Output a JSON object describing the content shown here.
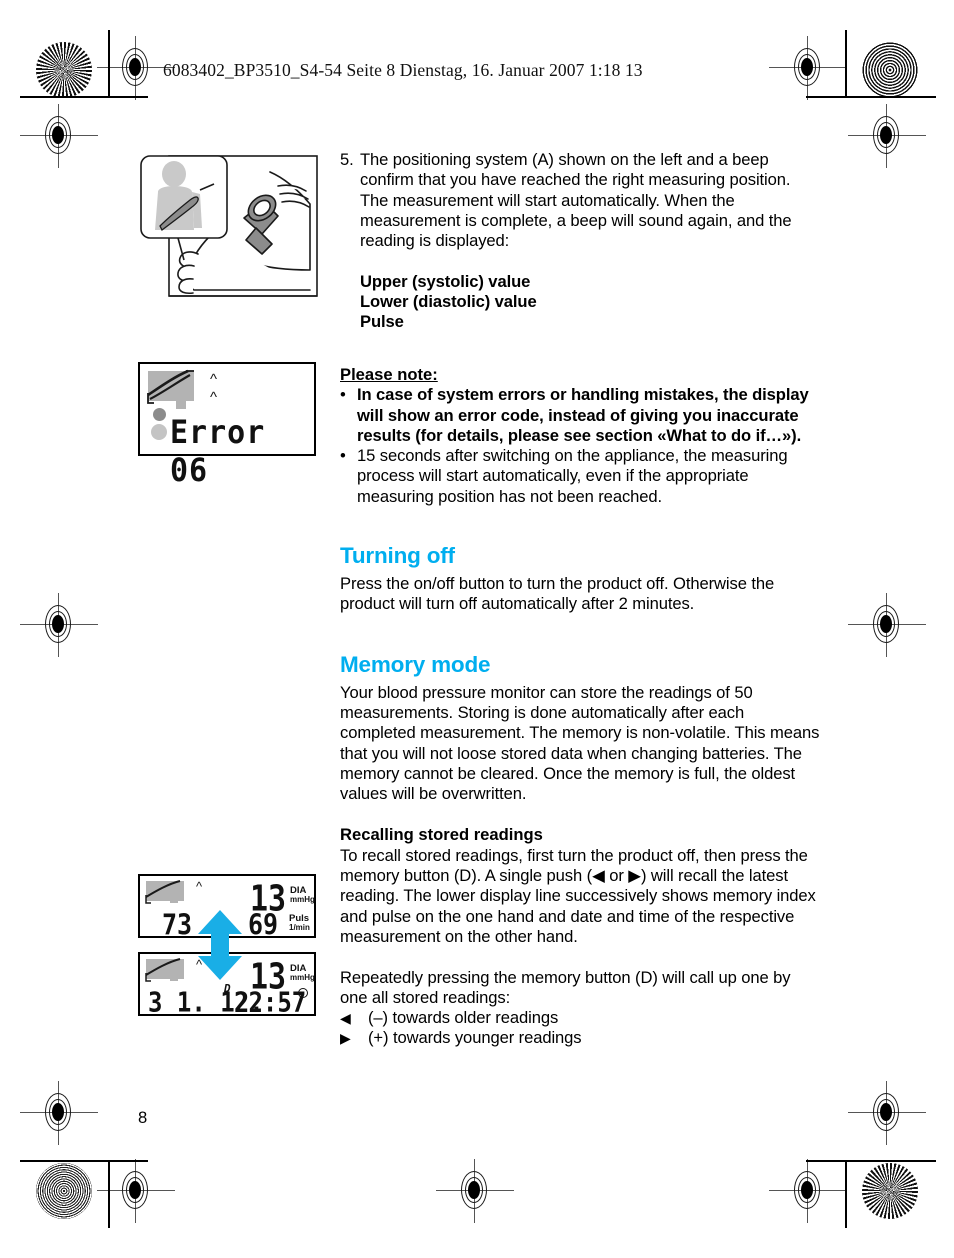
{
  "header": {
    "text": "6083402_BP3510_S4-54  Seite 8  Dienstag, 16. Januar 2007  1:18 13"
  },
  "page_number": "8",
  "colors": {
    "heading_blue": "#00AEEF",
    "lcd_gray": "#b3b3b3",
    "text_black": "#000000"
  },
  "content": {
    "step5": {
      "number": "5.",
      "text": "The positioning system (A) shown on the left and a beep confirm that you have reached the right measuring position. The measurement will start automatically. When the measurement is complete, a beep will sound again, and the reading is displayed:"
    },
    "reading_labels": [
      "Upper (systolic) value",
      "Lower (diastolic) value",
      "Pulse"
    ],
    "please_note": {
      "heading": "Please note:",
      "items": [
        {
          "bullet": "•",
          "bold": true,
          "text": "In case of system errors or handling mistakes, the display will show an error code, instead of giving you inaccurate results (for details, please see section «What to do if…»)."
        },
        {
          "bullet": "•",
          "bold": false,
          "text": "15 seconds after switching on the appliance, the measuring process will start automatically, even if the appropriate measuring position has not been reached."
        }
      ]
    },
    "turning_off": {
      "heading": "Turning off",
      "body": "Press the on/off button to turn the product off. Otherwise the product will turn off automatically after 2 minutes."
    },
    "memory_mode": {
      "heading": "Memory mode",
      "body": "Your blood pressure monitor can store the readings of 50 measurements. Storing is done automatically after each completed measurement. The memory is non-volatile. This means that you will not loose stored data when changing batteries. The memory cannot be cleared. Once the memory is full, the oldest values will be overwritten."
    },
    "recalling": {
      "heading": "Recalling stored readings",
      "body": "To recall stored readings, first turn the product off, then press the memory button (D). A single push (◀ or ▶) will recall the latest reading. The lower display line successively shows memory index and pulse on the one hand and date and time of the respective measurement on the other hand."
    },
    "repeatedly": {
      "body": "Repeatedly pressing the memory button (D) will call up one by one all stored readings:",
      "items": [
        {
          "arrow": "◀",
          "text": "(–) towards older readings"
        },
        {
          "arrow": "▶",
          "text": "(+) towards younger readings"
        }
      ]
    }
  },
  "figures": {
    "fig_positioning": {
      "caption_semantic": "arm-positioning-illustration"
    },
    "lcd_error": {
      "display_text": "Error 06"
    },
    "lcd_memory_top": {
      "main_value": "13",
      "main_unit_1": "DIA",
      "main_unit_2": "mmHg",
      "left_value": "73",
      "pulse_value": "69",
      "pulse_unit_1": "Puls",
      "pulse_unit_2": "1/min"
    },
    "lcd_memory_bottom": {
      "main_value": "13",
      "main_unit_1": "DIA",
      "main_unit_2": "mmHg",
      "date_value": "3 1. 12.",
      "date_superscript": "D",
      "time_value": "22:57",
      "time_symbol": "®"
    },
    "arrow_between": "⇅"
  }
}
